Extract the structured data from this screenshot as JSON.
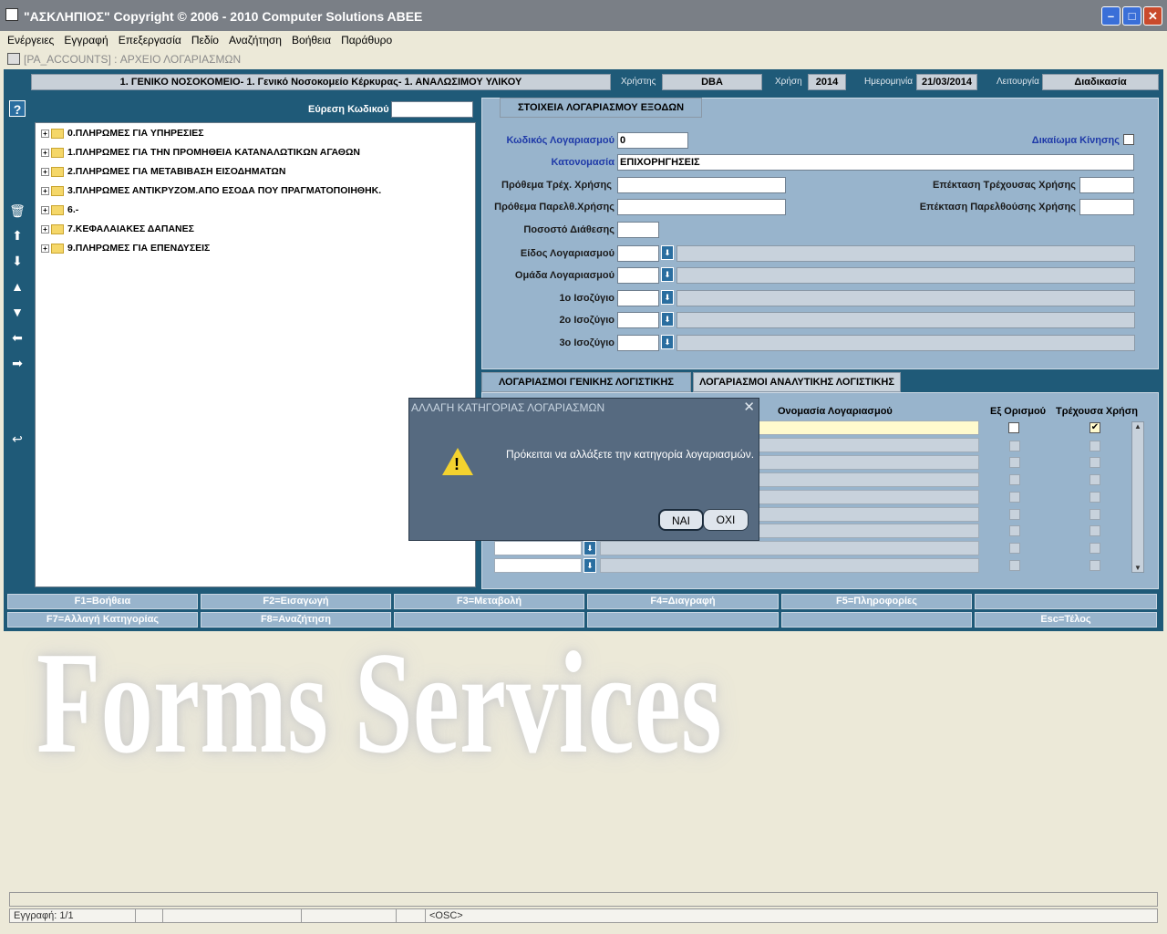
{
  "window": {
    "title": "\"ΑΣΚΛΗΠΙΟΣ\" Copyright © 2006 - 2010 Computer Solutions ABEE"
  },
  "menu": [
    "Ενέργειες",
    "Εγγραφή",
    "Επεξεργασία",
    "Πεδίο",
    "Αναζήτηση",
    "Βοήθεια",
    "Παράθυρο"
  ],
  "mdi": {
    "title": "[PA_ACCOUNTS]  :  ΑΡΧΕΙΟ ΛΟΓΑΡΙΑΣΜΩΝ"
  },
  "header": {
    "org": "1. ΓΕΝΙΚΟ ΝΟΣΟΚΟΜΕΙΟ- 1. Γενικό Νοσοκομείο Κέρκυρας- 1. ΑΝΑΛΩΣΙΜΟΥ ΥΛΙΚΟΥ",
    "user_label": "Χρήστης",
    "user": "DBA",
    "year_label": "Χρήση",
    "year": "2014",
    "date_label": "Ημερομηνία",
    "date": "21/03/2014",
    "func_label": "Λειτουργία",
    "func": "Διαδικασία"
  },
  "search": {
    "label": "Εύρεση Κωδικού",
    "value": ""
  },
  "tree": [
    "0.ΠΛΗΡΩΜΕΣ ΓΙΑ ΥΠΗΡΕΣΙΕΣ",
    "1.ΠΛΗΡΩΜΕΣ ΓΙΑ ΤΗΝ ΠΡΟΜΗΘΕΙΑ ΚΑΤΑΝΑΛΩΤΙΚΩΝ ΑΓΑΘΩΝ",
    "2.ΠΛΗΡΩΜΕΣ ΓΙΑ ΜΕΤΑΒΙΒΑΣΗ ΕΙΣΟΔΗΜΑΤΩΝ",
    "3.ΠΛΗΡΩΜΕΣ ΑΝΤΙΚΡΥΖΟΜ.ΑΠΟ ΕΣΟΔΑ ΠΟΥ ΠΡΑΓΜΑΤΟΠΟΙΗΘΗΚ.",
    "6.-",
    "7.ΚΕΦΑΛΑΙΑΚΕΣ ΔΑΠΑΝΕΣ",
    "9.ΠΛΗΡΩΜΕΣ ΓΙΑ ΕΠΕΝΔΥΣΕΙΣ"
  ],
  "details": {
    "tab": "ΣΤΟΙΧΕΙΑ ΛΟΓΑΡΙΑΣΜΟΥ ΕΞΟΔΩΝ",
    "code_label": "Κωδικός Λογαριασμού",
    "code": "0",
    "right_label": "Δικαίωμα Κίνησης",
    "name_label": "Κατονομασία",
    "name": "ΕΠΙΧΟΡΗΓΗΣΕΙΣ",
    "addcur_label": "Πρόθεμα Τρέχ. Χρήσης",
    "addprev_label": "Πρόθεμα Παρελθ.Χρήσης",
    "extcur_label": "Επέκταση Τρέχουσας Χρήσης",
    "extprev_label": "Επέκταση Παρελθούσης Χρήσης",
    "pct_label": "Ποσοστό Διάθεσης",
    "type_label": "Είδος Λογαριασμού",
    "group_label": "Ομάδα Λογαριασμού",
    "bal1_label": "1ο Ισοζύγιο",
    "bal2_label": "2ο Ισοζύγιο",
    "bal3_label": "3ο Ισοζύγιο"
  },
  "bottom": {
    "tab1": "ΛΟΓΑΡΙΑΣΜΟΙ ΓΕΝΙΚΗΣ ΛΟΓΙΣΤΙΚΗΣ",
    "tab2": "ΛΟΓΑΡΙΑΣΜΟΙ ΑΝΑΛΥΤΙΚΗΣ ΛΟΓΙΣΤΙΚΗΣ",
    "col_name": "Ονομασία Λογαριασμού",
    "col_default": "Εξ Ορισμού",
    "col_current": "Τρέχουσα Χρήση"
  },
  "fkeys": [
    "F1=Βοήθεια",
    "F2=Εισαγωγή",
    "F3=Μεταβολή",
    "F4=Διαγραφή",
    "F5=Πληροφορίες",
    "",
    "F7=Αλλαγή Κατηγορίας",
    "F8=Αναζήτηση",
    "",
    "",
    "",
    "Esc=Τέλος"
  ],
  "dialog": {
    "title": "ΑΛΛΑΓΗ ΚΑΤΗΓΟΡΙΑΣ ΛΟΓΑΡΙΑΣΜΩΝ",
    "message": "Πρόκειται να αλλάξετε την κατηγορία λογαριασμών.",
    "yes": "ΝΑΙ",
    "no": "ΟΧΙ"
  },
  "watermark": {
    "line1": "Forms Services"
  },
  "status": {
    "record": "Εγγραφή: 1/1",
    "osc": "<OSC>"
  }
}
